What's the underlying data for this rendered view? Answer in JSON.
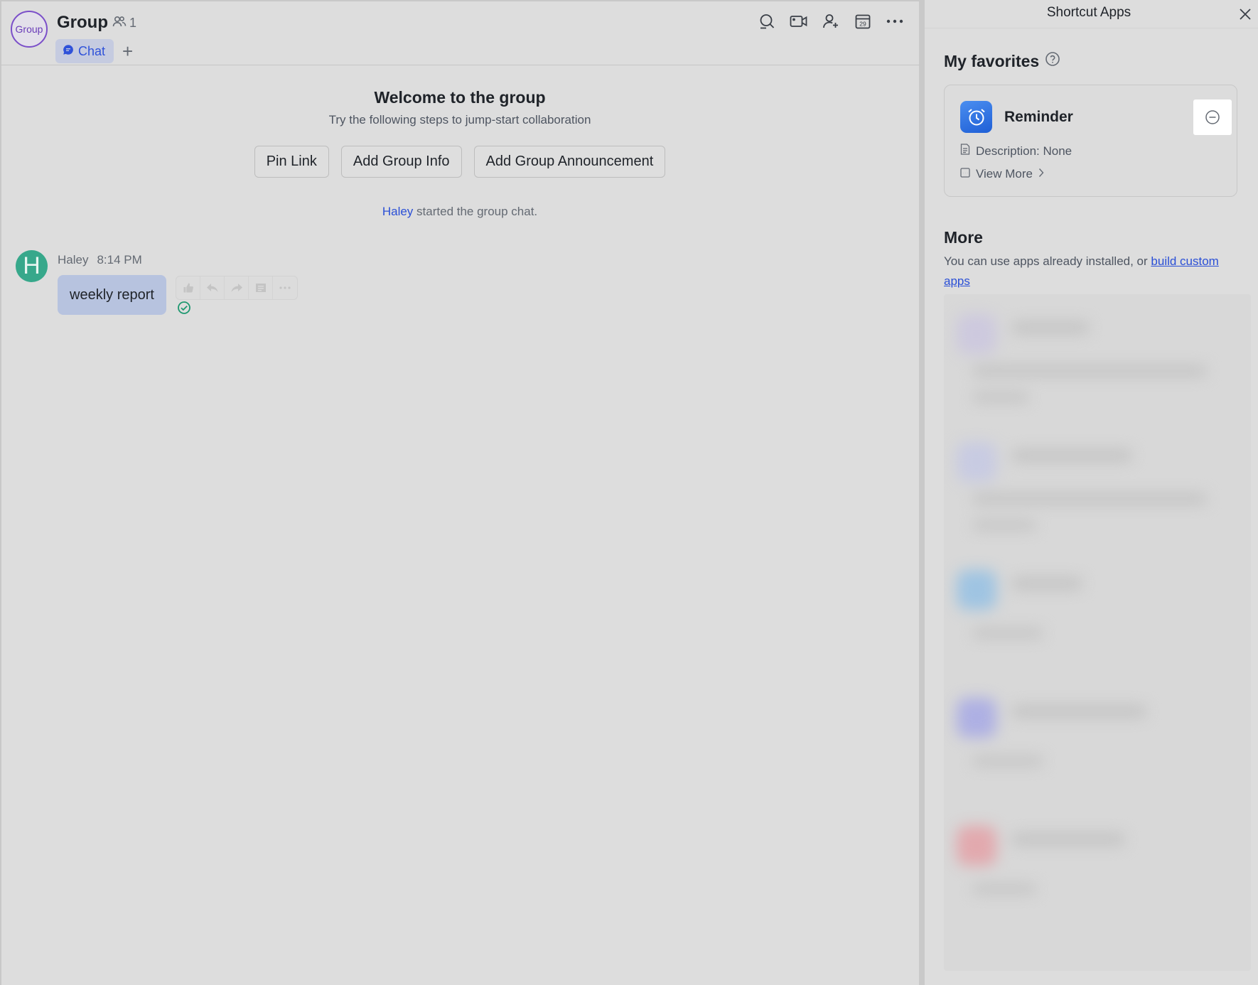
{
  "header": {
    "avatar_text": "Group",
    "title": "Group",
    "member_count": "1",
    "tab_chat": "Chat",
    "tab_add": "+"
  },
  "welcome": {
    "title": "Welcome to the group",
    "subtitle": "Try the following steps to jump-start collaboration",
    "buttons": [
      "Pin Link",
      "Add Group Info",
      "Add Group Announcement"
    ]
  },
  "system_message": {
    "user": "Haley",
    "text": "started the group chat."
  },
  "message": {
    "avatar_letter": "H",
    "sender": "Haley",
    "time": "8:14 PM",
    "text": "weekly report"
  },
  "panel": {
    "title": "Shortcut Apps",
    "favorites_heading": "My favorites",
    "favorite_app": {
      "name": "Reminder",
      "description": "Description: None",
      "view_more": "View More"
    },
    "more_heading": "More",
    "more_text": "You can use apps already installed, or ",
    "more_link": "build custom apps"
  },
  "colors": {
    "accent": "#2a4fd6",
    "avatar_green": "#37a88b",
    "bubble": "#b7c3df",
    "group_avatar": "#7b4fc9"
  }
}
